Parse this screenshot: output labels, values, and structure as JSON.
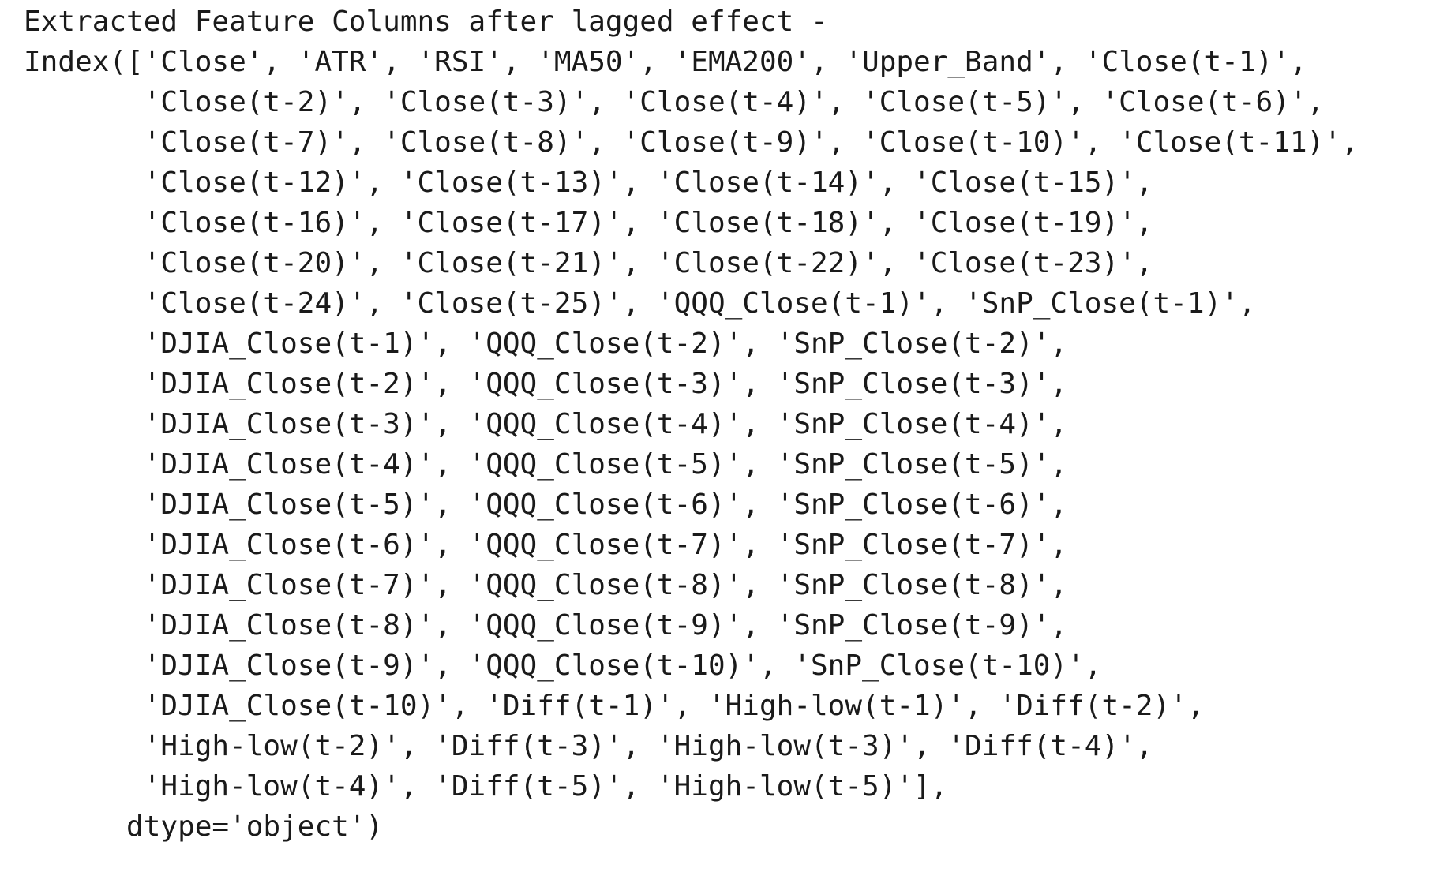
{
  "output": {
    "lines": [
      "Extracted Feature Columns after lagged effect -",
      "Index(['Close', 'ATR', 'RSI', 'MA50', 'EMA200', 'Upper_Band', 'Close(t-1)',",
      "       'Close(t-2)', 'Close(t-3)', 'Close(t-4)', 'Close(t-5)', 'Close(t-6)',",
      "       'Close(t-7)', 'Close(t-8)', 'Close(t-9)', 'Close(t-10)', 'Close(t-11)',",
      "       'Close(t-12)', 'Close(t-13)', 'Close(t-14)', 'Close(t-15)',",
      "       'Close(t-16)', 'Close(t-17)', 'Close(t-18)', 'Close(t-19)',",
      "       'Close(t-20)', 'Close(t-21)', 'Close(t-22)', 'Close(t-23)',",
      "       'Close(t-24)', 'Close(t-25)', 'QQQ_Close(t-1)', 'SnP_Close(t-1)',",
      "       'DJIA_Close(t-1)', 'QQQ_Close(t-2)', 'SnP_Close(t-2)',",
      "       'DJIA_Close(t-2)', 'QQQ_Close(t-3)', 'SnP_Close(t-3)',",
      "       'DJIA_Close(t-3)', 'QQQ_Close(t-4)', 'SnP_Close(t-4)',",
      "       'DJIA_Close(t-4)', 'QQQ_Close(t-5)', 'SnP_Close(t-5)',",
      "       'DJIA_Close(t-5)', 'QQQ_Close(t-6)', 'SnP_Close(t-6)',",
      "       'DJIA_Close(t-6)', 'QQQ_Close(t-7)', 'SnP_Close(t-7)',",
      "       'DJIA_Close(t-7)', 'QQQ_Close(t-8)', 'SnP_Close(t-8)',",
      "       'DJIA_Close(t-8)', 'QQQ_Close(t-9)', 'SnP_Close(t-9)',",
      "       'DJIA_Close(t-9)', 'QQQ_Close(t-10)', 'SnP_Close(t-10)',",
      "       'DJIA_Close(t-10)', 'Diff(t-1)', 'High-low(t-1)', 'Diff(t-2)',",
      "       'High-low(t-2)', 'Diff(t-3)', 'High-low(t-3)', 'Diff(t-4)',",
      "       'High-low(t-4)', 'Diff(t-5)', 'High-low(t-5)'],",
      "      dtype='object')"
    ]
  }
}
